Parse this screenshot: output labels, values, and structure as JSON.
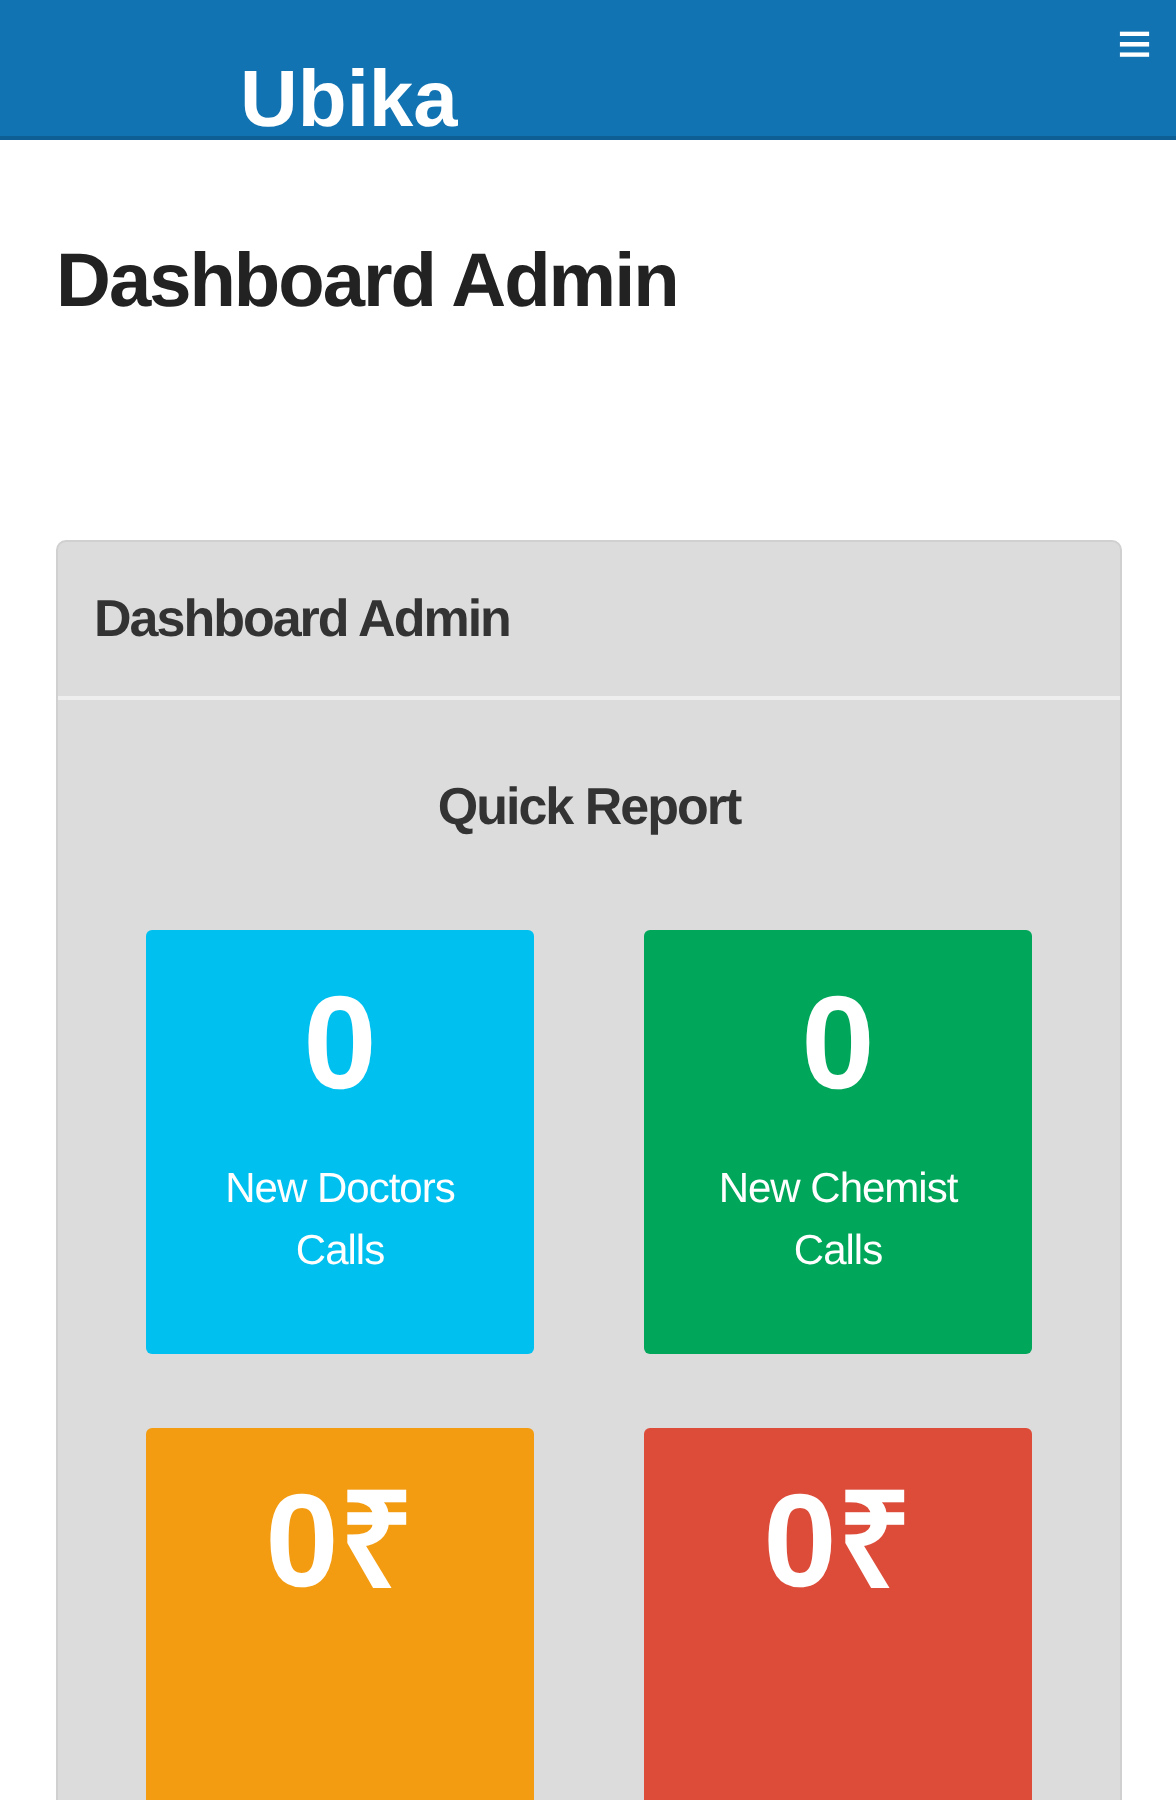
{
  "header": {
    "logo": "Ubika",
    "menu_icon": "≡"
  },
  "page_title": "Dashboard Admin",
  "panel": {
    "title": "Dashboard Admin",
    "section_title": "Quick Report",
    "tiles": [
      {
        "value": "0",
        "label": "New Doctors Calls",
        "color": "#00c0ef"
      },
      {
        "value": "0",
        "label": "New Chemist Calls",
        "color": "#00a65a"
      },
      {
        "value": "0₹",
        "color": "#f39c12"
      },
      {
        "value": "0₹",
        "color": "#dd4b39"
      }
    ]
  }
}
